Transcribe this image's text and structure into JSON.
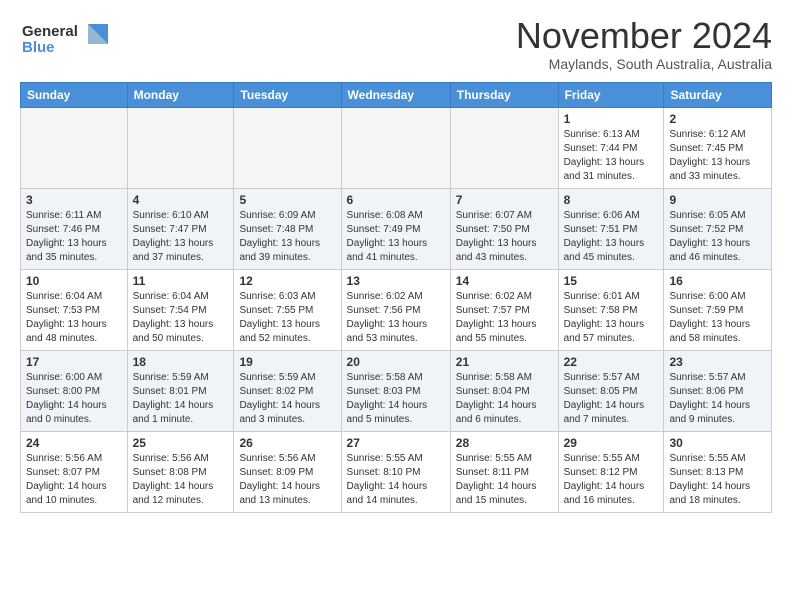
{
  "header": {
    "logo_line1": "General",
    "logo_line2": "Blue",
    "title": "November 2024",
    "subtitle": "Maylands, South Australia, Australia"
  },
  "columns": [
    "Sunday",
    "Monday",
    "Tuesday",
    "Wednesday",
    "Thursday",
    "Friday",
    "Saturday"
  ],
  "weeks": [
    [
      {
        "day": "",
        "info": ""
      },
      {
        "day": "",
        "info": ""
      },
      {
        "day": "",
        "info": ""
      },
      {
        "day": "",
        "info": ""
      },
      {
        "day": "",
        "info": ""
      },
      {
        "day": "1",
        "info": "Sunrise: 6:13 AM\nSunset: 7:44 PM\nDaylight: 13 hours\nand 31 minutes."
      },
      {
        "day": "2",
        "info": "Sunrise: 6:12 AM\nSunset: 7:45 PM\nDaylight: 13 hours\nand 33 minutes."
      }
    ],
    [
      {
        "day": "3",
        "info": "Sunrise: 6:11 AM\nSunset: 7:46 PM\nDaylight: 13 hours\nand 35 minutes."
      },
      {
        "day": "4",
        "info": "Sunrise: 6:10 AM\nSunset: 7:47 PM\nDaylight: 13 hours\nand 37 minutes."
      },
      {
        "day": "5",
        "info": "Sunrise: 6:09 AM\nSunset: 7:48 PM\nDaylight: 13 hours\nand 39 minutes."
      },
      {
        "day": "6",
        "info": "Sunrise: 6:08 AM\nSunset: 7:49 PM\nDaylight: 13 hours\nand 41 minutes."
      },
      {
        "day": "7",
        "info": "Sunrise: 6:07 AM\nSunset: 7:50 PM\nDaylight: 13 hours\nand 43 minutes."
      },
      {
        "day": "8",
        "info": "Sunrise: 6:06 AM\nSunset: 7:51 PM\nDaylight: 13 hours\nand 45 minutes."
      },
      {
        "day": "9",
        "info": "Sunrise: 6:05 AM\nSunset: 7:52 PM\nDaylight: 13 hours\nand 46 minutes."
      }
    ],
    [
      {
        "day": "10",
        "info": "Sunrise: 6:04 AM\nSunset: 7:53 PM\nDaylight: 13 hours\nand 48 minutes."
      },
      {
        "day": "11",
        "info": "Sunrise: 6:04 AM\nSunset: 7:54 PM\nDaylight: 13 hours\nand 50 minutes."
      },
      {
        "day": "12",
        "info": "Sunrise: 6:03 AM\nSunset: 7:55 PM\nDaylight: 13 hours\nand 52 minutes."
      },
      {
        "day": "13",
        "info": "Sunrise: 6:02 AM\nSunset: 7:56 PM\nDaylight: 13 hours\nand 53 minutes."
      },
      {
        "day": "14",
        "info": "Sunrise: 6:02 AM\nSunset: 7:57 PM\nDaylight: 13 hours\nand 55 minutes."
      },
      {
        "day": "15",
        "info": "Sunrise: 6:01 AM\nSunset: 7:58 PM\nDaylight: 13 hours\nand 57 minutes."
      },
      {
        "day": "16",
        "info": "Sunrise: 6:00 AM\nSunset: 7:59 PM\nDaylight: 13 hours\nand 58 minutes."
      }
    ],
    [
      {
        "day": "17",
        "info": "Sunrise: 6:00 AM\nSunset: 8:00 PM\nDaylight: 14 hours\nand 0 minutes."
      },
      {
        "day": "18",
        "info": "Sunrise: 5:59 AM\nSunset: 8:01 PM\nDaylight: 14 hours\nand 1 minute."
      },
      {
        "day": "19",
        "info": "Sunrise: 5:59 AM\nSunset: 8:02 PM\nDaylight: 14 hours\nand 3 minutes."
      },
      {
        "day": "20",
        "info": "Sunrise: 5:58 AM\nSunset: 8:03 PM\nDaylight: 14 hours\nand 5 minutes."
      },
      {
        "day": "21",
        "info": "Sunrise: 5:58 AM\nSunset: 8:04 PM\nDaylight: 14 hours\nand 6 minutes."
      },
      {
        "day": "22",
        "info": "Sunrise: 5:57 AM\nSunset: 8:05 PM\nDaylight: 14 hours\nand 7 minutes."
      },
      {
        "day": "23",
        "info": "Sunrise: 5:57 AM\nSunset: 8:06 PM\nDaylight: 14 hours\nand 9 minutes."
      }
    ],
    [
      {
        "day": "24",
        "info": "Sunrise: 5:56 AM\nSunset: 8:07 PM\nDaylight: 14 hours\nand 10 minutes."
      },
      {
        "day": "25",
        "info": "Sunrise: 5:56 AM\nSunset: 8:08 PM\nDaylight: 14 hours\nand 12 minutes."
      },
      {
        "day": "26",
        "info": "Sunrise: 5:56 AM\nSunset: 8:09 PM\nDaylight: 14 hours\nand 13 minutes."
      },
      {
        "day": "27",
        "info": "Sunrise: 5:55 AM\nSunset: 8:10 PM\nDaylight: 14 hours\nand 14 minutes."
      },
      {
        "day": "28",
        "info": "Sunrise: 5:55 AM\nSunset: 8:11 PM\nDaylight: 14 hours\nand 15 minutes."
      },
      {
        "day": "29",
        "info": "Sunrise: 5:55 AM\nSunset: 8:12 PM\nDaylight: 14 hours\nand 16 minutes."
      },
      {
        "day": "30",
        "info": "Sunrise: 5:55 AM\nSunset: 8:13 PM\nDaylight: 14 hours\nand 18 minutes."
      }
    ]
  ]
}
